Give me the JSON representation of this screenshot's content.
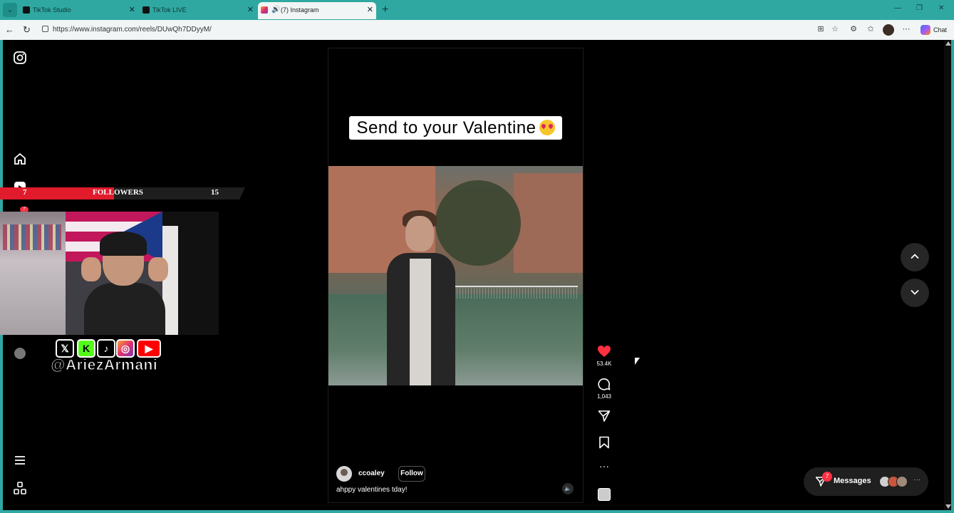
{
  "browser": {
    "tabs": [
      {
        "label": "TikTok Studio",
        "active": false
      },
      {
        "label": "TikTok LIVE",
        "active": false
      },
      {
        "label": "(7) Instagram",
        "active": true
      }
    ],
    "url": "https://www.instagram.com/reels/DUwQh7DDyyM/",
    "chat_label": "Chat"
  },
  "overlay": {
    "followers_current": "7",
    "followers_label": "FOLLOWERS",
    "followers_goal": "15",
    "followers_progress": 0.47,
    "handle": "@AriezArmani",
    "nav_badge": "7"
  },
  "reel": {
    "banner_text": "Send to your Valentine",
    "username": "ccoaley",
    "follow_label": "Follow",
    "caption": "ahppy valentines tday!",
    "likes": "53.4K",
    "comments": "1,043"
  },
  "messages": {
    "label": "Messages",
    "badge": "7"
  },
  "colors": {
    "chrome_accent": "#2fa8a2",
    "like_red": "#ff3040",
    "followers_red": "#e01b2c"
  }
}
